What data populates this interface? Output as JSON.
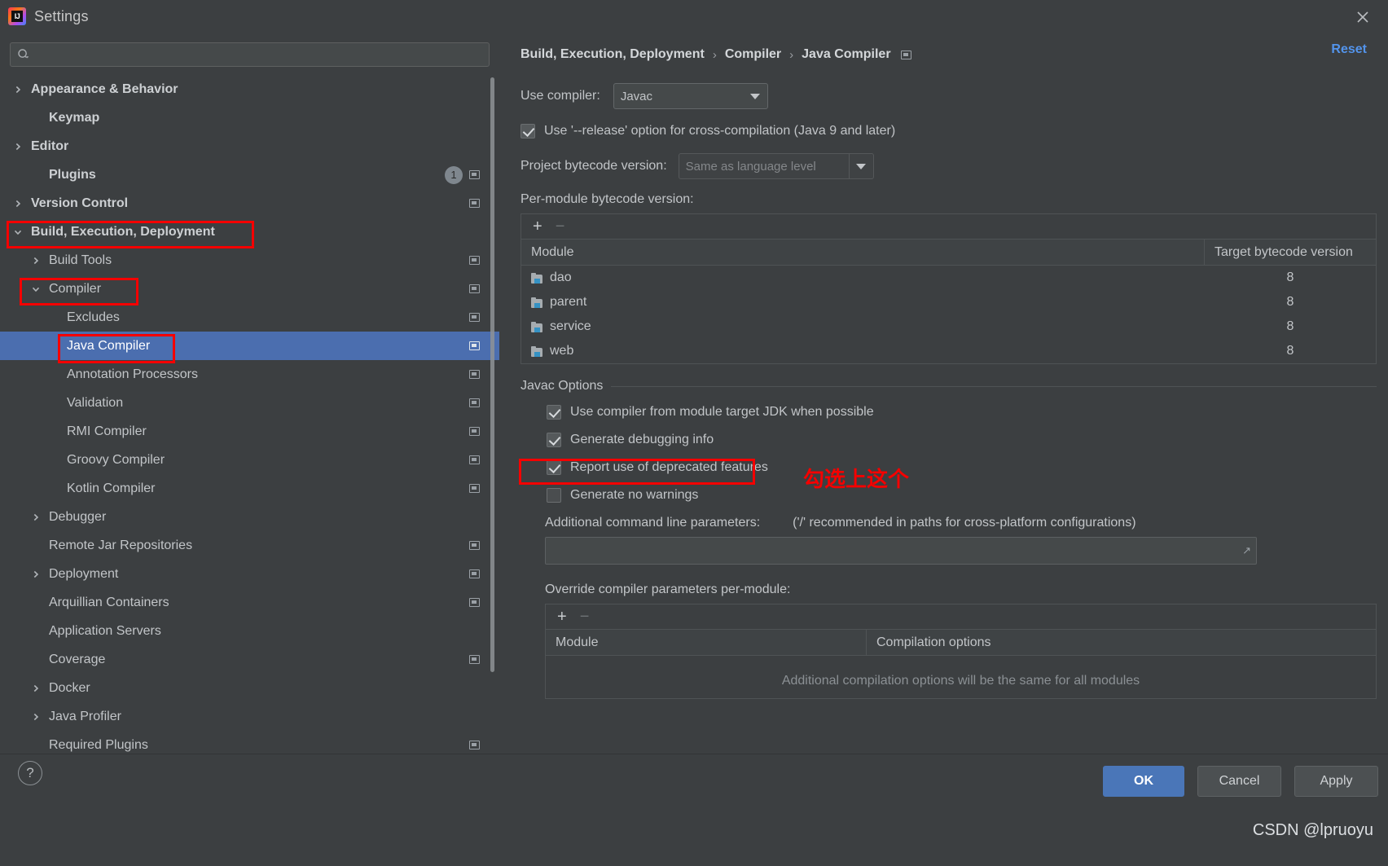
{
  "window": {
    "title": "Settings",
    "logo_text": "IJ",
    "close_icon": "close-icon"
  },
  "sidebar": {
    "search": {
      "placeholder": "",
      "value": "",
      "icon": "search-icon"
    },
    "items": [
      {
        "label": "Appearance & Behavior",
        "arrow": "collapsed",
        "indent": 0,
        "bold": true,
        "badge": "",
        "mini": false,
        "selected": false
      },
      {
        "label": "Keymap",
        "arrow": "none",
        "indent": 1,
        "bold": true,
        "badge": "",
        "mini": false,
        "selected": false
      },
      {
        "label": "Editor",
        "arrow": "collapsed",
        "indent": 0,
        "bold": true,
        "badge": "",
        "mini": false,
        "selected": false
      },
      {
        "label": "Plugins",
        "arrow": "none",
        "indent": 1,
        "bold": true,
        "badge": "1",
        "mini": true,
        "selected": false
      },
      {
        "label": "Version Control",
        "arrow": "collapsed",
        "indent": 0,
        "bold": true,
        "badge": "",
        "mini": true,
        "selected": false
      },
      {
        "label": "Build, Execution, Deployment",
        "arrow": "expanded",
        "indent": 0,
        "bold": true,
        "badge": "",
        "mini": false,
        "selected": false
      },
      {
        "label": "Build Tools",
        "arrow": "collapsed",
        "indent": 1,
        "bold": false,
        "badge": "",
        "mini": true,
        "selected": false
      },
      {
        "label": "Compiler",
        "arrow": "expanded",
        "indent": 1,
        "bold": false,
        "badge": "",
        "mini": true,
        "selected": false
      },
      {
        "label": "Excludes",
        "arrow": "none",
        "indent": 2,
        "bold": false,
        "badge": "",
        "mini": true,
        "selected": false
      },
      {
        "label": "Java Compiler",
        "arrow": "none",
        "indent": 2,
        "bold": false,
        "badge": "",
        "mini": true,
        "selected": true
      },
      {
        "label": "Annotation Processors",
        "arrow": "none",
        "indent": 2,
        "bold": false,
        "badge": "",
        "mini": true,
        "selected": false
      },
      {
        "label": "Validation",
        "arrow": "none",
        "indent": 2,
        "bold": false,
        "badge": "",
        "mini": true,
        "selected": false
      },
      {
        "label": "RMI Compiler",
        "arrow": "none",
        "indent": 2,
        "bold": false,
        "badge": "",
        "mini": true,
        "selected": false
      },
      {
        "label": "Groovy Compiler",
        "arrow": "none",
        "indent": 2,
        "bold": false,
        "badge": "",
        "mini": true,
        "selected": false
      },
      {
        "label": "Kotlin Compiler",
        "arrow": "none",
        "indent": 2,
        "bold": false,
        "badge": "",
        "mini": true,
        "selected": false
      },
      {
        "label": "Debugger",
        "arrow": "collapsed",
        "indent": 1,
        "bold": false,
        "badge": "",
        "mini": false,
        "selected": false
      },
      {
        "label": "Remote Jar Repositories",
        "arrow": "none",
        "indent": 1,
        "bold": false,
        "badge": "",
        "mini": true,
        "selected": false
      },
      {
        "label": "Deployment",
        "arrow": "collapsed",
        "indent": 1,
        "bold": false,
        "badge": "",
        "mini": true,
        "selected": false
      },
      {
        "label": "Arquillian Containers",
        "arrow": "none",
        "indent": 1,
        "bold": false,
        "badge": "",
        "mini": true,
        "selected": false
      },
      {
        "label": "Application Servers",
        "arrow": "none",
        "indent": 1,
        "bold": false,
        "badge": "",
        "mini": false,
        "selected": false
      },
      {
        "label": "Coverage",
        "arrow": "none",
        "indent": 1,
        "bold": false,
        "badge": "",
        "mini": true,
        "selected": false
      },
      {
        "label": "Docker",
        "arrow": "collapsed",
        "indent": 1,
        "bold": false,
        "badge": "",
        "mini": false,
        "selected": false
      },
      {
        "label": "Java Profiler",
        "arrow": "collapsed",
        "indent": 1,
        "bold": false,
        "badge": "",
        "mini": false,
        "selected": false
      },
      {
        "label": "Required Plugins",
        "arrow": "none",
        "indent": 1,
        "bold": false,
        "badge": "",
        "mini": true,
        "selected": false
      }
    ]
  },
  "header": {
    "breadcrumb": [
      "Build, Execution, Deployment",
      "Compiler",
      "Java Compiler"
    ],
    "separator": "›",
    "reset_label": "Reset",
    "trailing_icon": "settings-copy-icon"
  },
  "main": {
    "use_compiler_label": "Use compiler:",
    "use_compiler_value": "Javac",
    "release_option": {
      "label": "Use '--release' option for cross-compilation (Java 9 and later)",
      "checked": true
    },
    "project_bytecode_label": "Project bytecode version:",
    "project_bytecode_value": "Same as language level",
    "per_module_label": "Per-module bytecode version:",
    "add_icon": "plus-icon",
    "remove_icon": "minus-icon",
    "module_table": {
      "columns": [
        "Module",
        "Target bytecode version"
      ],
      "rows": [
        {
          "module": "dao",
          "target": "8"
        },
        {
          "module": "parent",
          "target": "8"
        },
        {
          "module": "service",
          "target": "8"
        },
        {
          "module": "web",
          "target": "8"
        }
      ]
    },
    "javac_options_title": "Javac Options",
    "javac_checkboxes": [
      {
        "label": "Use compiler from module target JDK when possible",
        "checked": true
      },
      {
        "label": "Generate debugging info",
        "checked": true
      },
      {
        "label": "Report use of deprecated features",
        "checked": true
      },
      {
        "label": "Generate no warnings",
        "checked": false
      }
    ],
    "additional_params_label": "Additional command line parameters:",
    "additional_params_hint": "('/' recommended in paths for cross-platform configurations)",
    "additional_params_value": "",
    "override_label": "Override compiler parameters per-module:",
    "override_table": {
      "columns": [
        "Module",
        "Compilation options"
      ],
      "empty_note": "Additional compilation options will be the same for all modules"
    }
  },
  "footer": {
    "help_label": "?",
    "ok_label": "OK",
    "cancel_label": "Cancel",
    "apply_label": "Apply"
  },
  "annotations": {
    "note_text": "勾选上这个",
    "color": "#f50000"
  },
  "watermark": "CSDN @lpruoyu"
}
